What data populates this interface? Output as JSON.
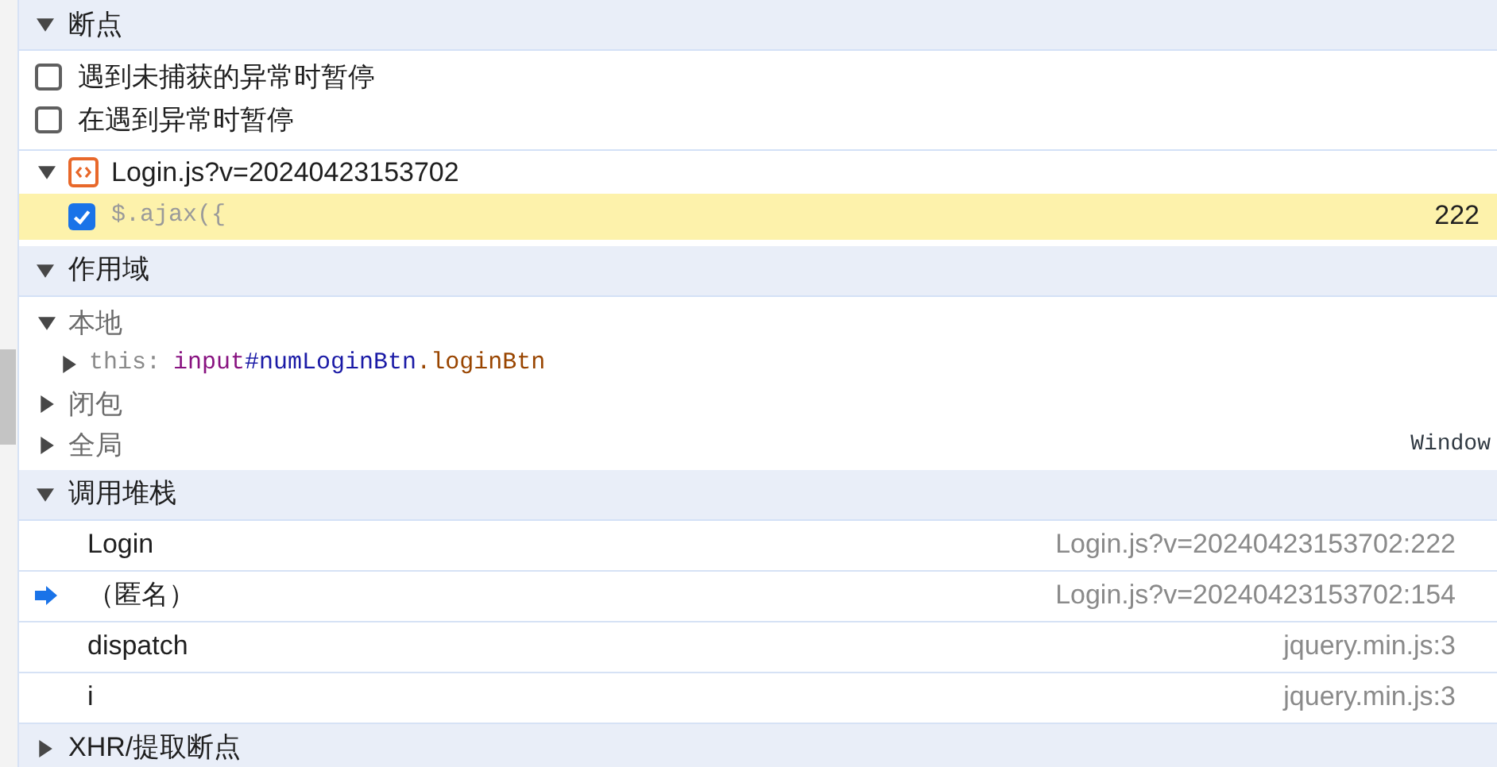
{
  "sections": [
    {
      "kind": "breakpoints",
      "title": "断点",
      "expanded": true,
      "pause_options": [
        {
          "label": "遇到未捕获的异常时暂停",
          "checked": false
        },
        {
          "label": "在遇到异常时暂停",
          "checked": false
        }
      ],
      "files": [
        {
          "name": "Login.js?v=20240423153702",
          "expanded": true,
          "breakpoints": [
            {
              "code": "$.ajax({",
              "line": "222",
              "checked": true
            }
          ]
        }
      ]
    },
    {
      "kind": "scope",
      "title": "作用域",
      "expanded": true,
      "scopes": [
        {
          "name": "本地",
          "expanded": true,
          "children": [
            {
              "key": "this:",
              "value_parts": [
                {
                  "text": "input",
                  "kind": "tag"
                },
                {
                  "text": "#numLoginBtn",
                  "kind": "id"
                },
                {
                  "text": ".loginBtn",
                  "kind": "class"
                }
              ],
              "expanded": false
            }
          ]
        },
        {
          "name": "闭包",
          "expanded": false
        },
        {
          "name": "全局",
          "expanded": false,
          "value": "Window"
        }
      ]
    },
    {
      "kind": "call_stack",
      "title": "调用堆栈",
      "expanded": true,
      "frames": [
        {
          "name": "Login",
          "location": "Login.js?v=20240423153702:222",
          "selected": false
        },
        {
          "name": "（匿名）",
          "location": "Login.js?v=20240423153702:154",
          "selected": true
        },
        {
          "name": "dispatch",
          "location": "jquery.min.js:3",
          "selected": false
        },
        {
          "name": "i",
          "location": "jquery.min.js:3",
          "selected": false
        }
      ]
    },
    {
      "kind": "collapsed",
      "title": "XHR/提取断点",
      "expanded": false
    }
  ]
}
